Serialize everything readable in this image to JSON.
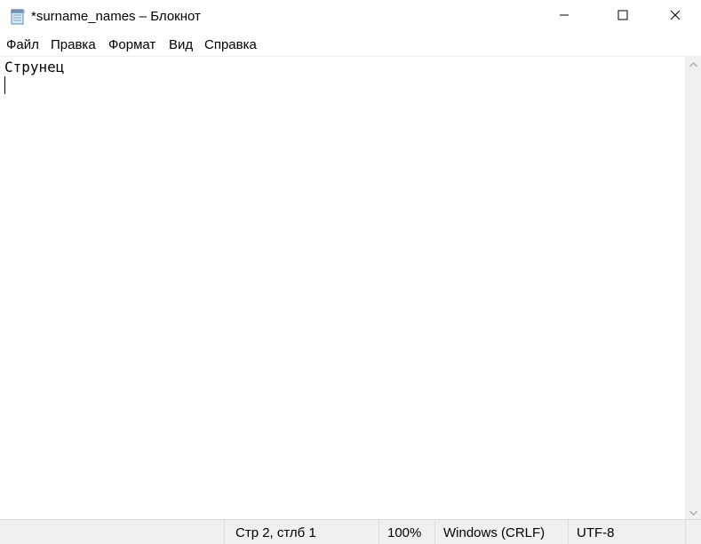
{
  "window": {
    "title": "*surname_names – Блокнот",
    "icon": "notepad-icon",
    "controls": [
      "minimize-icon",
      "maximize-icon",
      "close-icon"
    ]
  },
  "menu": {
    "file": "Файл",
    "edit": "Правка",
    "format": "Формат",
    "view": "Вид",
    "help": "Справка"
  },
  "editor": {
    "lines": [
      "Струнец",
      ""
    ]
  },
  "status": {
    "position": "Стр 2, стлб 1",
    "zoom": "100%",
    "line_ending": "Windows (CRLF)",
    "encoding": "UTF-8"
  }
}
